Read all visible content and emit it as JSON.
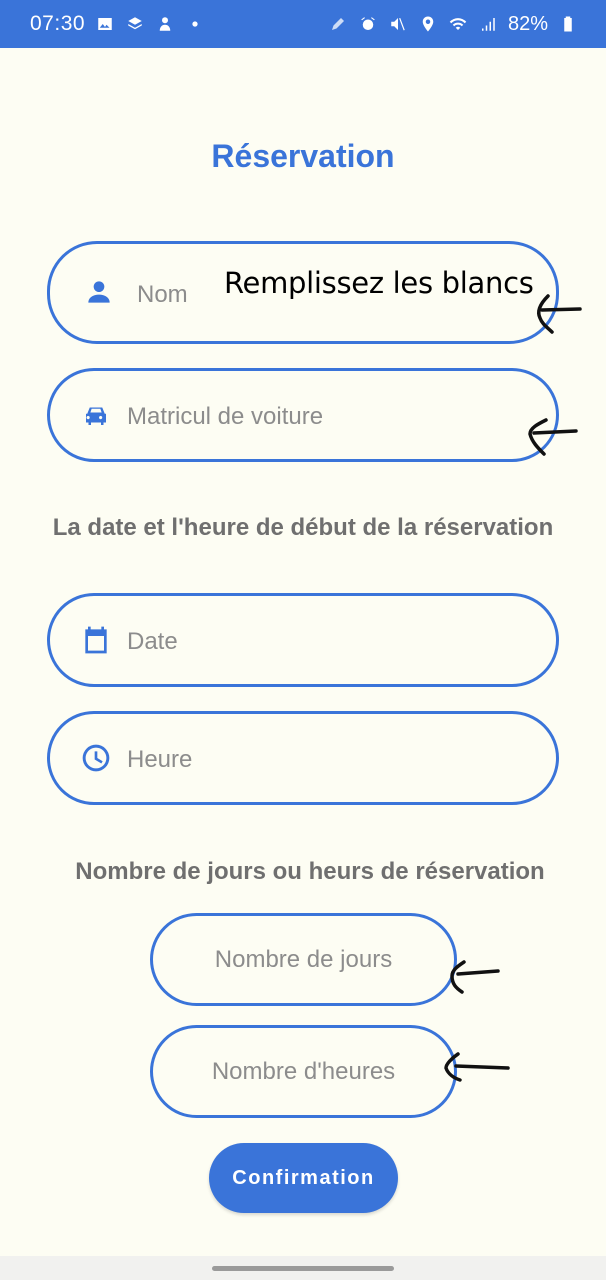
{
  "status_bar": {
    "time": "07:30",
    "left_icons": [
      "image-icon",
      "stack-icon",
      "notification-app-icon",
      "dot-icon"
    ],
    "right_icons": [
      "pen-icon",
      "alarm-icon",
      "mute-icon",
      "location-icon",
      "wifi-icon",
      "signal-icon"
    ],
    "battery": "82%",
    "color": "#3a74d9"
  },
  "page": {
    "title": "Réservation",
    "accent_color": "#3a74d9",
    "background": "#fdfdf3"
  },
  "fields": {
    "name": {
      "placeholder": "Nom",
      "icon": "person-icon"
    },
    "car": {
      "placeholder": "Matricul de voiture",
      "icon": "car-icon"
    },
    "date": {
      "placeholder": "Date",
      "icon": "calendar-icon"
    },
    "time": {
      "placeholder": "Heure",
      "icon": "clock-icon"
    },
    "days": {
      "placeholder": "Nombre de jours"
    },
    "hours": {
      "placeholder": "Nombre d'heures"
    }
  },
  "annotation": {
    "text": "Remplissez les blancs"
  },
  "sections": {
    "start_label": "La date et l'heure de début de la réservation",
    "duration_label": "Nombre de jours ou heurs de réservation"
  },
  "actions": {
    "confirm_label": "Confirmation"
  }
}
